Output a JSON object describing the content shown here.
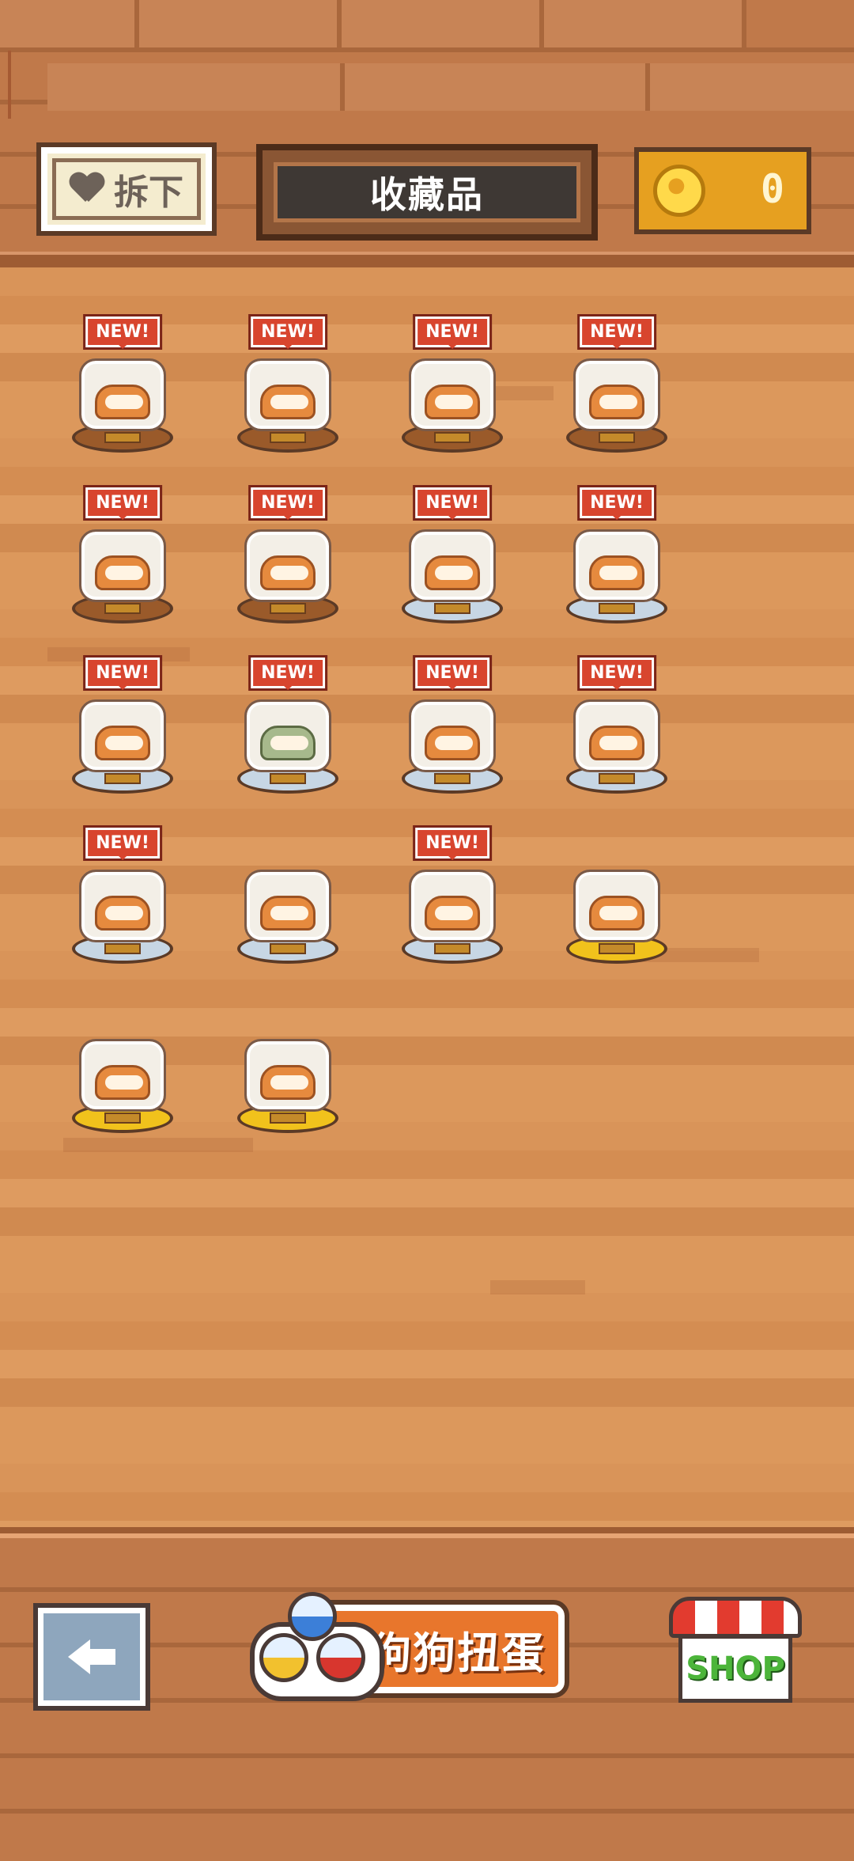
{
  "header": {
    "remove_label": "拆下",
    "title": "收藏品",
    "coins": "0"
  },
  "collection": {
    "badge_text": "NEW!",
    "items": [
      {
        "row": 1,
        "col": 1,
        "new": true,
        "pedestal": "wood",
        "icon": "dog-lying-figure"
      },
      {
        "row": 1,
        "col": 2,
        "new": true,
        "pedestal": "wood",
        "icon": "dog-with-food-bowl"
      },
      {
        "row": 1,
        "col": 3,
        "new": true,
        "pedestal": "wood",
        "icon": "dog-with-cactus"
      },
      {
        "row": 1,
        "col": 4,
        "new": true,
        "pedestal": "wood",
        "icon": "wardrobe"
      },
      {
        "row": 2,
        "col": 1,
        "new": true,
        "pedestal": "wood",
        "icon": "plant-on-table"
      },
      {
        "row": 2,
        "col": 2,
        "new": true,
        "pedestal": "wood",
        "icon": "dog-with-red-hat"
      },
      {
        "row": 2,
        "col": 3,
        "new": true,
        "pedestal": "silver",
        "icon": "dog-on-red-chair"
      },
      {
        "row": 2,
        "col": 4,
        "new": true,
        "pedestal": "silver",
        "icon": "round-window"
      },
      {
        "row": 3,
        "col": 1,
        "new": true,
        "pedestal": "silver",
        "icon": "dog-on-armchair"
      },
      {
        "row": 3,
        "col": 2,
        "new": true,
        "pedestal": "silver",
        "icon": "green-cat"
      },
      {
        "row": 3,
        "col": 3,
        "new": true,
        "pedestal": "silver",
        "icon": "dog-with-stove"
      },
      {
        "row": 3,
        "col": 4,
        "new": true,
        "pedestal": "silver",
        "icon": "boy-with-dog"
      },
      {
        "row": 4,
        "col": 1,
        "new": true,
        "pedestal": "silver",
        "icon": "dog-with-table"
      },
      {
        "row": 4,
        "col": 2,
        "new": false,
        "pedestal": "silver",
        "icon": "dog-with-skewer"
      },
      {
        "row": 4,
        "col": 3,
        "new": true,
        "pedestal": "silver",
        "icon": "dog-with-marbles"
      },
      {
        "row": 4,
        "col": 4,
        "new": false,
        "pedestal": "gold",
        "icon": "doorway"
      },
      {
        "row": 5,
        "col": 1,
        "new": false,
        "pedestal": "gold",
        "icon": "dog-with-teapot"
      },
      {
        "row": 5,
        "col": 2,
        "new": false,
        "pedestal": "gold",
        "icon": "dog-on-cushion"
      }
    ]
  },
  "footer": {
    "gacha_label": "狗狗扭蛋",
    "shop_label": "SHOP"
  },
  "colors": {
    "badge": "#d8452e",
    "coin": "#e6a020",
    "gacha": "#e8762c",
    "shop_text": "#4cb53a"
  }
}
